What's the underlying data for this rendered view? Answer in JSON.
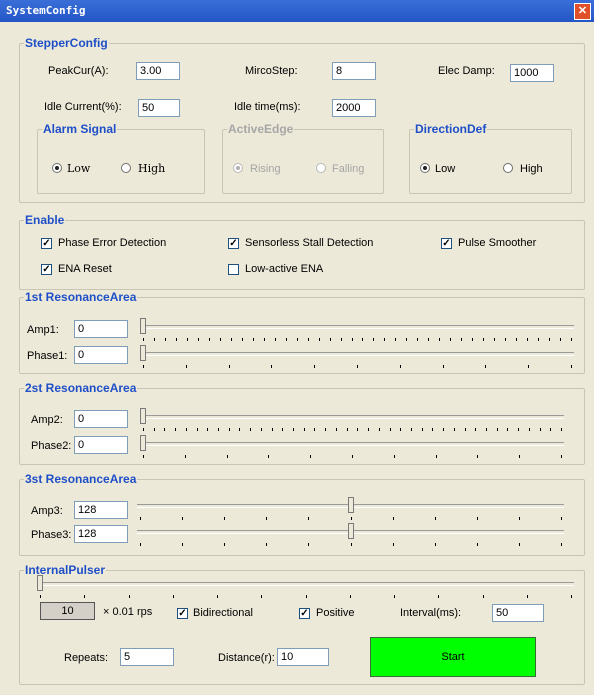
{
  "window": {
    "title": "SystemConfig",
    "close_icon": "close-icon"
  },
  "stepper": {
    "legend": "StepperConfig",
    "peak_cur_label": "PeakCur(A):",
    "peak_cur_value": "3.00",
    "micro_step_label": "MircoStep:",
    "micro_step_value": "8",
    "elec_damp_label": "Elec Damp:",
    "elec_damp_value": "1000",
    "idle_current_label": "Idle Current(%):",
    "idle_current_value": "50",
    "idle_time_label": "Idle time(ms):",
    "idle_time_value": "2000",
    "alarm": {
      "legend": "Alarm Signal",
      "low": "Low",
      "high": "High",
      "selected": "Low"
    },
    "active_edge": {
      "legend": "ActiveEdge",
      "rising": "Rising",
      "falling": "Falling",
      "selected": "Rising",
      "enabled": false
    },
    "direction": {
      "legend": "DirectionDef",
      "low": "Low",
      "high": "High",
      "selected": "Low"
    }
  },
  "enable": {
    "legend": "Enable",
    "items": [
      {
        "label": "Phase Error Detection",
        "checked": true
      },
      {
        "label": "Sensorless Stall Detection",
        "checked": true
      },
      {
        "label": "Pulse Smoother",
        "checked": true
      },
      {
        "label": "ENA Reset",
        "checked": true
      },
      {
        "label": "Low-active ENA",
        "checked": false
      }
    ]
  },
  "resonance1": {
    "legend": "1st ResonanceArea",
    "amp_label": "Amp1:",
    "amp_value": "0",
    "phase_label": "Phase1:",
    "phase_value": "0",
    "amp_level": 0,
    "phase_level": 0
  },
  "resonance2": {
    "legend": "2st ResonanceArea",
    "amp_label": "Amp2:",
    "amp_value": "0",
    "phase_label": "Phase2:",
    "phase_value": "0",
    "amp_level": 0,
    "phase_level": 0
  },
  "resonance3": {
    "legend": "3st ResonanceArea",
    "amp_label": "Amp3:",
    "amp_value": "128",
    "phase_label": "Phase3:",
    "phase_value": "128",
    "amp_level": 0.5,
    "phase_level": 0.5
  },
  "pulser": {
    "legend": "InternalPulser",
    "speed_value": "10",
    "speed_unit": "× 0.01 rps",
    "speed_level": 0,
    "bidirectional_label": "Bidirectional",
    "bidirectional_checked": true,
    "positive_label": "Positive",
    "positive_checked": true,
    "interval_label": "Interval(ms):",
    "interval_value": "50",
    "repeats_label": "Repeats:",
    "repeats_value": "5",
    "distance_label": "Distance(r):",
    "distance_value": "10",
    "start_label": "Start"
  },
  "colors": {
    "legend": "#1f4fc8",
    "start_button": "#00ff00",
    "titlebar": "#2456c6"
  }
}
